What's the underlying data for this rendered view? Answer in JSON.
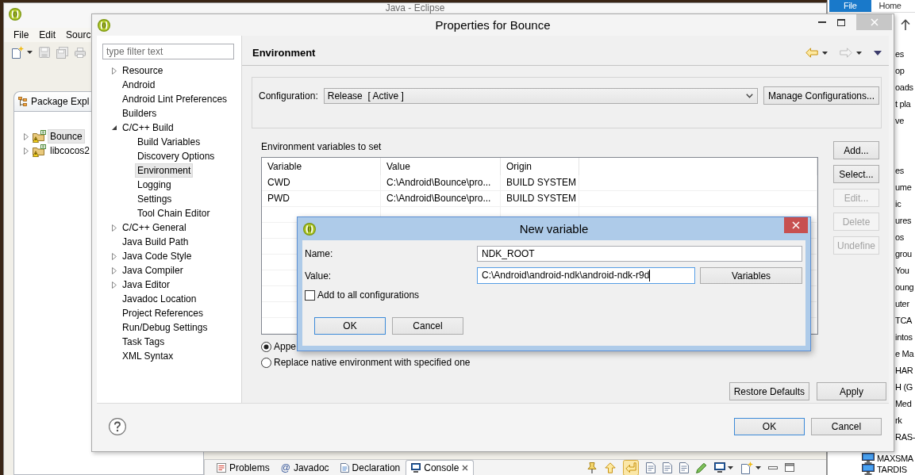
{
  "eclipse_window": {
    "title": "Java - Eclipse",
    "menu": [
      "File",
      "Edit",
      "Sourc"
    ],
    "package_explorer": {
      "tab_label": "Package Expl",
      "items": [
        {
          "label": "Bounce",
          "selected": true,
          "expanded": false
        },
        {
          "label": "libcocos2",
          "selected": false,
          "expanded": false
        }
      ]
    },
    "bottom_tabs": [
      {
        "kind": "problems",
        "label": "Problems",
        "selected": false
      },
      {
        "kind": "javadoc",
        "glyph": "@",
        "label": "Javadoc",
        "selected": false
      },
      {
        "kind": "declaration",
        "label": "Declaration",
        "selected": false
      },
      {
        "kind": "console",
        "label": "Console",
        "selected": true
      }
    ],
    "console_toolbar": [
      {
        "kind": "pin",
        "on": false
      },
      {
        "kind": "up",
        "on": false
      },
      {
        "kind": "return",
        "on": true
      },
      {
        "kind": "page",
        "on": false
      },
      {
        "kind": "page",
        "on": false
      },
      {
        "kind": "page",
        "on": false
      },
      {
        "kind": "pen",
        "on": false
      },
      {
        "kind": "monitor",
        "on": false
      },
      {
        "kind": "new-page",
        "on": false
      },
      {
        "kind": "minimize",
        "on": false
      },
      {
        "kind": "maximize",
        "on": false
      }
    ]
  },
  "explorer_window": {
    "ribbon": [
      {
        "kind": "menu",
        "label": "File"
      },
      {
        "kind": "tab",
        "label": "Home"
      }
    ],
    "groups": [
      {
        "items": [
          {
            "kind": "fragment",
            "text": "es"
          },
          {
            "kind": "fragment",
            "text": "op"
          },
          {
            "kind": "fragment",
            "text": "oads"
          },
          {
            "kind": "fragment",
            "text": "t pla"
          },
          {
            "kind": "fragment",
            "text": "ve"
          }
        ]
      },
      {
        "items": [
          {
            "kind": "fragment",
            "text": "es"
          },
          {
            "kind": "fragment",
            "text": "ume"
          },
          {
            "kind": "fragment",
            "text": "ic"
          },
          {
            "kind": "fragment",
            "text": "ures"
          },
          {
            "kind": "fragment",
            "text": "os"
          },
          {
            "kind": "fragment",
            "text": "grou"
          },
          {
            "kind": "fragment",
            "text": "You"
          },
          {
            "kind": "fragment",
            "text": "oung"
          },
          {
            "kind": "fragment",
            "text": "uter"
          },
          {
            "kind": "fragment",
            "text": "TCA"
          },
          {
            "kind": "fragment",
            "text": "intos"
          },
          {
            "kind": "fragment",
            "text": "e Ma"
          },
          {
            "kind": "fragment",
            "text": "HAR"
          },
          {
            "kind": "fragment",
            "text": "H (G"
          },
          {
            "kind": "fragment",
            "text": "Med"
          },
          {
            "kind": "fragment",
            "text": "rk"
          },
          {
            "kind": "fragment",
            "text": "RAS-"
          },
          {
            "kind": "computer",
            "text": "MAXSMA"
          },
          {
            "kind": "computer",
            "text": "TARDIS"
          }
        ]
      }
    ]
  },
  "properties_dialog": {
    "title": "Properties for Bounce",
    "filter": {
      "placeholder": "type filter text"
    },
    "tree": [
      {
        "label": "Resource",
        "selected": false,
        "expanded": false
      },
      {
        "label": "Android",
        "selected": false
      },
      {
        "label": "Android Lint Preferences",
        "selected": false
      },
      {
        "label": "Builders",
        "selected": false
      },
      {
        "label": "C/C++ Build",
        "selected": false,
        "expanded": true,
        "children": [
          {
            "label": "Build Variables",
            "selected": false
          },
          {
            "label": "Discovery Options",
            "selected": false
          },
          {
            "label": "Environment",
            "selected": true
          },
          {
            "label": "Logging",
            "selected": false
          },
          {
            "label": "Settings",
            "selected": false
          },
          {
            "label": "Tool Chain Editor",
            "selected": false
          }
        ]
      },
      {
        "label": "C/C++ General",
        "selected": false,
        "expanded": false
      },
      {
        "label": "Java Build Path",
        "selected": false
      },
      {
        "label": "Java Code Style",
        "selected": false,
        "expanded": false
      },
      {
        "label": "Java Compiler",
        "selected": false,
        "expanded": false
      },
      {
        "label": "Java Editor",
        "selected": false,
        "expanded": false
      },
      {
        "label": "Javadoc Location",
        "selected": false
      },
      {
        "label": "Project References",
        "selected": false
      },
      {
        "label": "Run/Debug Settings",
        "selected": false
      },
      {
        "label": "Task Tags",
        "selected": false
      },
      {
        "label": "XML Syntax",
        "selected": false
      }
    ],
    "page_title": "Environment",
    "history_nav": [
      {
        "kind": "back",
        "disabled": false
      },
      {
        "kind": "forward",
        "disabled": true
      }
    ],
    "configuration": {
      "label": "Configuration:",
      "value": "Release  [ Active ]",
      "button": "Manage Configurations..."
    },
    "variables": {
      "label": "Environment variables to set",
      "columns": [
        "Variable",
        "Value",
        "Origin"
      ],
      "rows": [
        [
          "CWD",
          "C:\\Android\\Bounce\\pro...",
          "BUILD SYSTEM"
        ],
        [
          "PWD",
          "C:\\Android\\Bounce\\pro...",
          "BUILD SYSTEM"
        ]
      ]
    },
    "side_buttons": [
      {
        "label": "Add...",
        "disabled": false
      },
      {
        "label": "Select...",
        "disabled": false
      },
      {
        "label": "Edit...",
        "disabled": true
      },
      {
        "label": "Delete",
        "disabled": true
      },
      {
        "label": "Undefine",
        "disabled": true
      }
    ],
    "mode_options": [
      {
        "label": "Appe",
        "selected": true
      },
      {
        "label": "Replace native environment with specified one",
        "selected": false
      }
    ],
    "page_buttons": [
      "Restore Defaults",
      "Apply"
    ],
    "buttons": [
      {
        "label": "OK",
        "default": true
      },
      {
        "label": "Cancel",
        "default": false
      }
    ]
  },
  "new_variable_dialog": {
    "title": "New variable",
    "fields": [
      {
        "label": "Name:",
        "value": "NDK_ROOT",
        "focused": false
      },
      {
        "label": "Value:",
        "value": "C:\\Android\\android-ndk\\android-ndk-r9d",
        "focused": true,
        "button": "Variables"
      }
    ],
    "checkbox": {
      "label": "Add to all configurations",
      "checked": false
    },
    "buttons": [
      {
        "label": "OK",
        "default": true
      },
      {
        "label": "Cancel",
        "default": false
      }
    ]
  }
}
